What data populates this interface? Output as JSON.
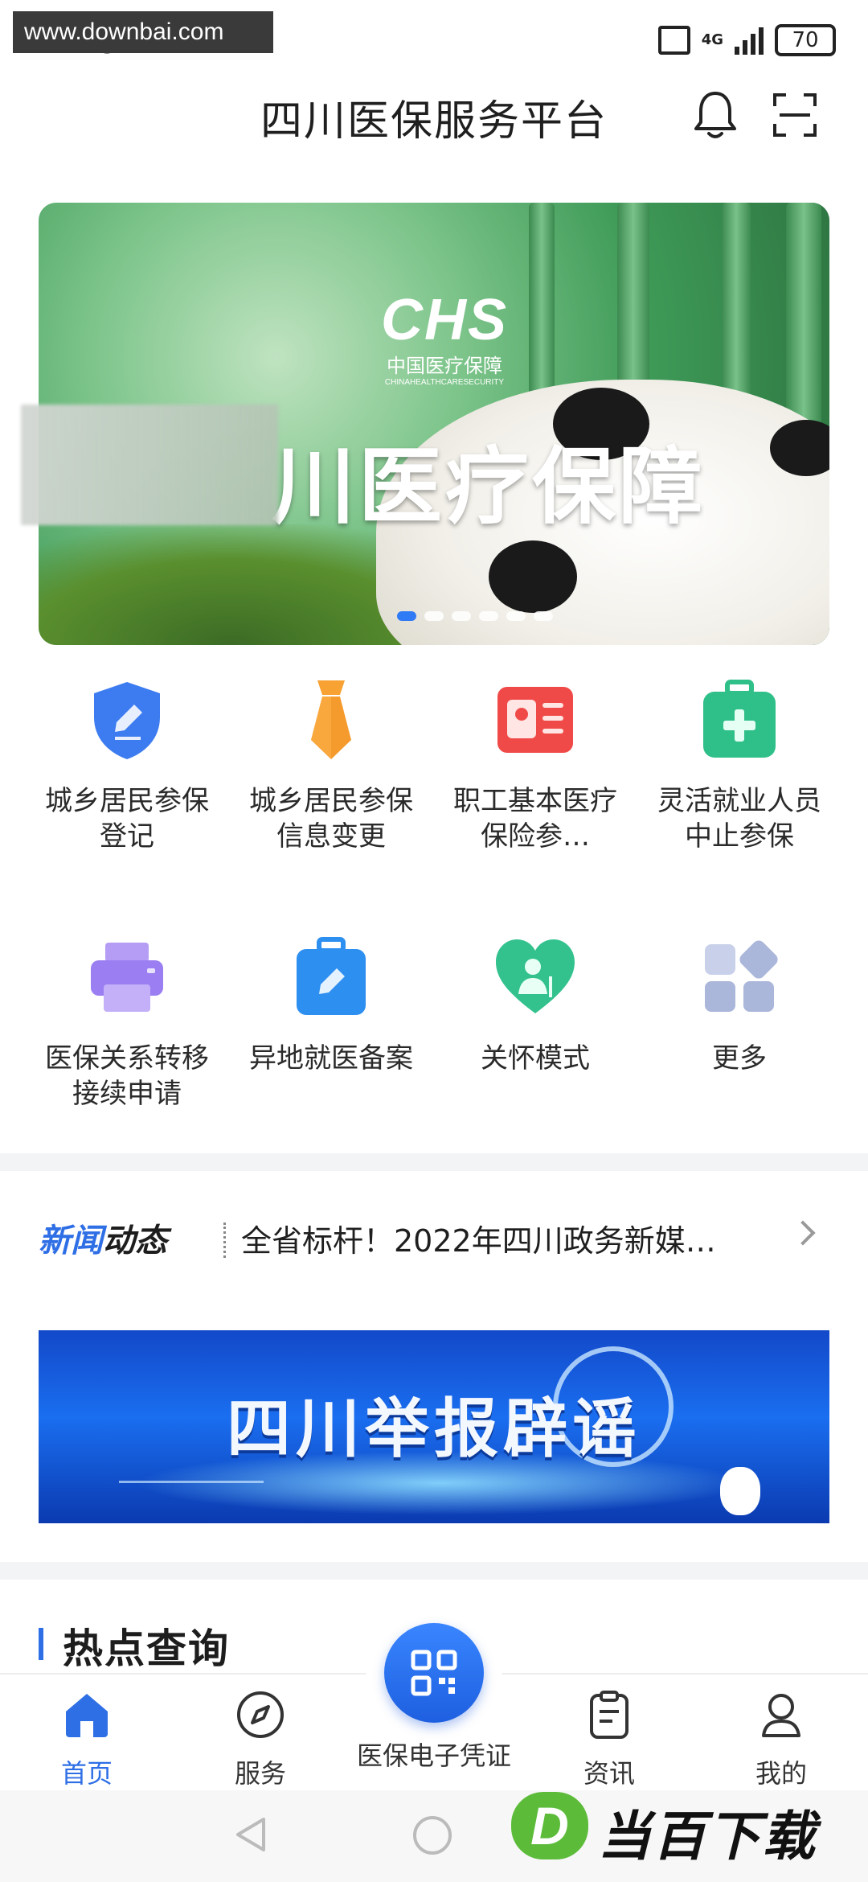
{
  "status_bar": {
    "watermark": "www.downbai.com",
    "time": "2:18",
    "network": "4G",
    "battery": "70"
  },
  "header": {
    "title": "四川医保服务平台"
  },
  "banner": {
    "logo_text": "CHS",
    "logo_cn": "中国医疗保障",
    "logo_en": "CHINAHEALTHCARESECURITY",
    "headline": "川医疗保障",
    "slides": 6,
    "active_slide": 1
  },
  "services": [
    {
      "label": "城乡居民参保登记",
      "icon": "shield-pen-icon"
    },
    {
      "label": "城乡居民参保信息变更",
      "icon": "tie-icon"
    },
    {
      "label": "职工基本医疗保险参…",
      "icon": "id-card-icon"
    },
    {
      "label": "灵活就业人员中止参保",
      "icon": "medical-kit-icon"
    },
    {
      "label": "医保关系转移接续申请",
      "icon": "printer-icon"
    },
    {
      "label": "异地就医备案",
      "icon": "briefcase-pen-icon"
    },
    {
      "label": "关怀模式",
      "icon": "heart-person-icon"
    },
    {
      "label": "更多",
      "icon": "grid-more-icon"
    }
  ],
  "news": {
    "title_a": "新闻",
    "title_b": "动态",
    "headline": "全省标杆！2022年四川政务新媒…"
  },
  "promo": {
    "title": "四川举报辟谣"
  },
  "hot": {
    "title": "热点查询"
  },
  "tabs": [
    {
      "label": "首页",
      "icon": "home-icon",
      "active": true
    },
    {
      "label": "服务",
      "icon": "compass-icon",
      "active": false
    },
    {
      "label": "医保电子凭证",
      "icon": "qr-code-icon",
      "active": false
    },
    {
      "label": "资讯",
      "icon": "clipboard-icon",
      "active": false
    },
    {
      "label": "我的",
      "icon": "user-icon",
      "active": false
    }
  ],
  "watermark_bottom": {
    "letter": "D",
    "text": "当百下载"
  },
  "colors": {
    "accent": "#2f6fe6",
    "banner_green": "#3e9a57",
    "promo_blue": "#1a6ef0"
  }
}
